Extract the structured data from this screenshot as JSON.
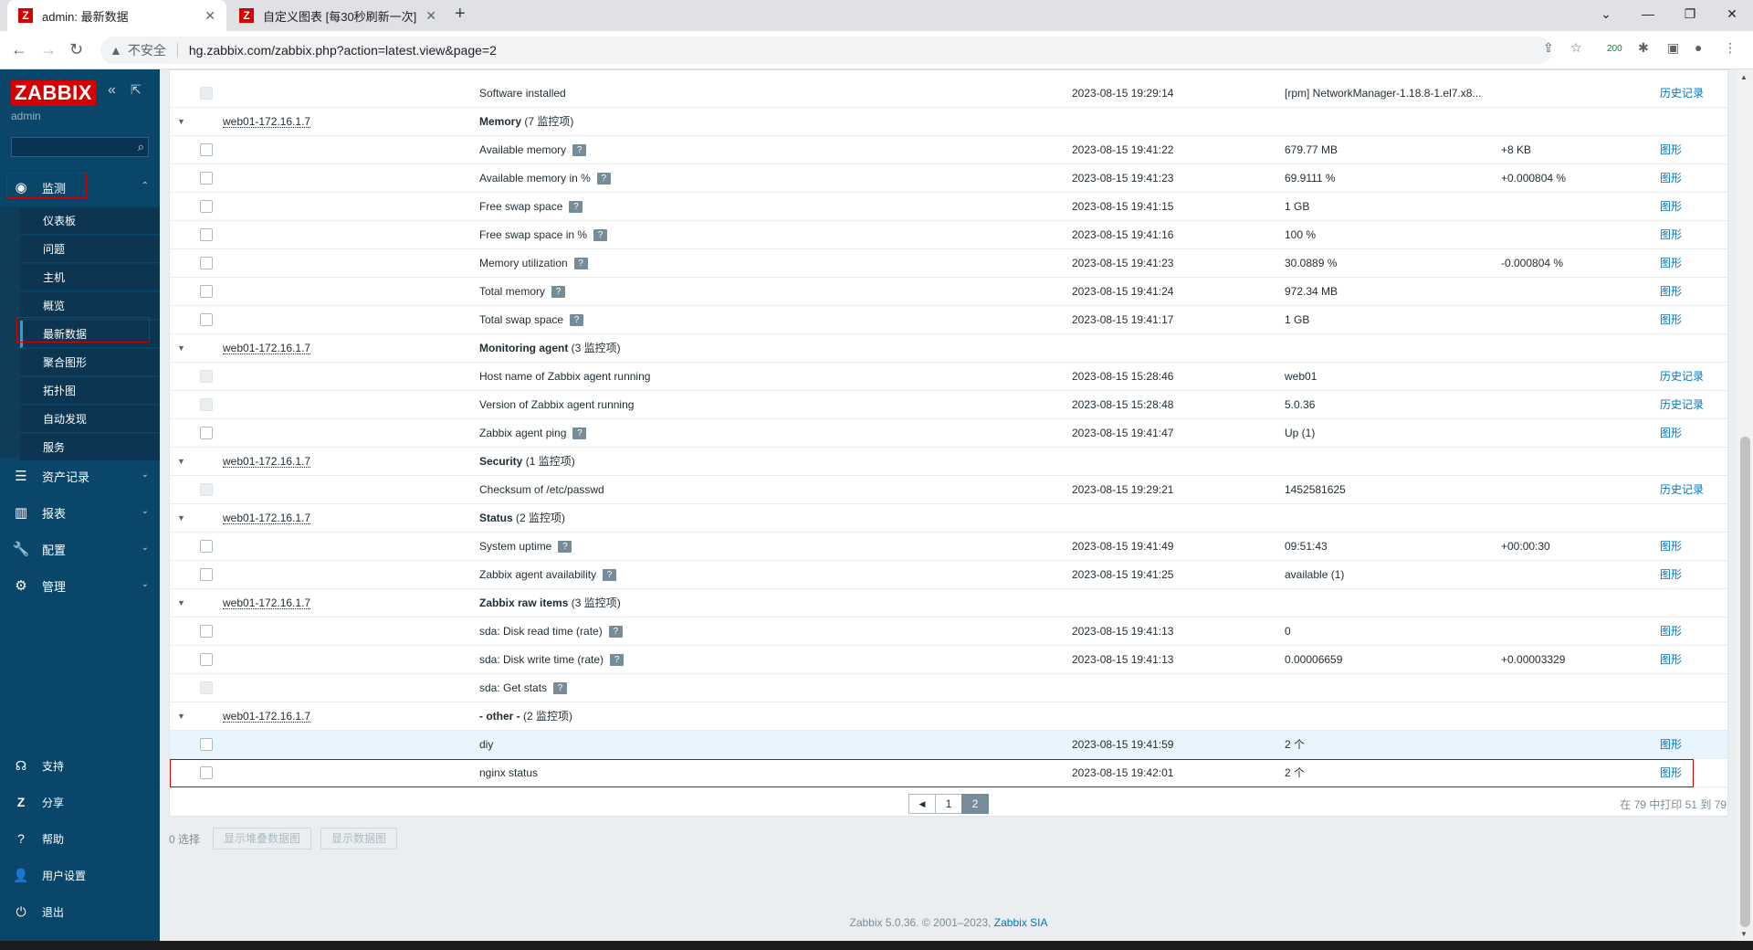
{
  "browser": {
    "tabs": [
      {
        "label": "admin: 最新数据",
        "favicon": "Z"
      },
      {
        "label": "自定义图表 [每30秒刷新一次]",
        "favicon": "Z"
      }
    ],
    "address": {
      "warning": "不安全",
      "url": "hg.zabbix.com/zabbix.php?action=latest.view&page=2"
    },
    "ext_badge": "200"
  },
  "sidebar": {
    "logo": "ZABBIX",
    "user": "admin",
    "search_placeholder": "",
    "main": [
      {
        "label": "监测",
        "icon": "eye-icon"
      },
      {
        "label": "资产记录",
        "icon": "list-icon"
      },
      {
        "label": "报表",
        "icon": "chart-icon"
      },
      {
        "label": "配置",
        "icon": "wrench-icon"
      },
      {
        "label": "管理",
        "icon": "gear-icon"
      }
    ],
    "submenu": [
      "仪表板",
      "问题",
      "主机",
      "概览",
      "最新数据",
      "聚合图形",
      "拓扑图",
      "自动发现",
      "服务"
    ],
    "bottom": [
      {
        "label": "支持",
        "icon": "support-icon"
      },
      {
        "label": "分享",
        "icon": "share-icon"
      },
      {
        "label": "帮助",
        "icon": "help-icon"
      },
      {
        "label": "用户设置",
        "icon": "user-icon"
      },
      {
        "label": "退出",
        "icon": "power-icon"
      }
    ]
  },
  "rows": [
    {
      "type": "item",
      "disabled": true,
      "name": "Software installed",
      "help": false,
      "ts": "2023-08-15 19:29:14",
      "value": "[rpm] NetworkManager-1.18.8-1.el7.x8...",
      "change": "",
      "action": "历史记录"
    },
    {
      "type": "group",
      "host": "web01-172.16.1.7",
      "group": "Memory",
      "count": "(7 监控项)"
    },
    {
      "type": "item",
      "name": "Available memory",
      "help": true,
      "ts": "2023-08-15 19:41:22",
      "value": "679.77 MB",
      "change": "+8 KB",
      "action": "图形"
    },
    {
      "type": "item",
      "name": "Available memory in %",
      "help": true,
      "ts": "2023-08-15 19:41:23",
      "value": "69.9111 %",
      "change": "+0.000804 %",
      "action": "图形"
    },
    {
      "type": "item",
      "name": "Free swap space",
      "help": true,
      "ts": "2023-08-15 19:41:15",
      "value": "1 GB",
      "change": "",
      "action": "图形"
    },
    {
      "type": "item",
      "name": "Free swap space in %",
      "help": true,
      "ts": "2023-08-15 19:41:16",
      "value": "100 %",
      "change": "",
      "action": "图形"
    },
    {
      "type": "item",
      "name": "Memory utilization",
      "help": true,
      "ts": "2023-08-15 19:41:23",
      "value": "30.0889 %",
      "change": "-0.000804 %",
      "action": "图形"
    },
    {
      "type": "item",
      "name": "Total memory",
      "help": true,
      "ts": "2023-08-15 19:41:24",
      "value": "972.34 MB",
      "change": "",
      "action": "图形"
    },
    {
      "type": "item",
      "name": "Total swap space",
      "help": true,
      "ts": "2023-08-15 19:41:17",
      "value": "1 GB",
      "change": "",
      "action": "图形"
    },
    {
      "type": "group",
      "host": "web01-172.16.1.7",
      "group": "Monitoring agent",
      "count": "(3 监控项)"
    },
    {
      "type": "item",
      "disabled": true,
      "name": "Host name of Zabbix agent running",
      "help": false,
      "ts": "2023-08-15 15:28:46",
      "value": "web01",
      "change": "",
      "action": "历史记录"
    },
    {
      "type": "item",
      "disabled": true,
      "name": "Version of Zabbix agent running",
      "help": false,
      "ts": "2023-08-15 15:28:48",
      "value": "5.0.36",
      "change": "",
      "action": "历史记录"
    },
    {
      "type": "item",
      "name": "Zabbix agent ping",
      "help": true,
      "ts": "2023-08-15 19:41:47",
      "value": "Up (1)",
      "change": "",
      "action": "图形"
    },
    {
      "type": "group",
      "host": "web01-172.16.1.7",
      "group": "Security",
      "count": "(1 监控项)"
    },
    {
      "type": "item",
      "disabled": true,
      "name": "Checksum of /etc/passwd",
      "help": false,
      "ts": "2023-08-15 19:29:21",
      "value": "1452581625",
      "change": "",
      "action": "历史记录"
    },
    {
      "type": "group",
      "host": "web01-172.16.1.7",
      "group": "Status",
      "count": "(2 监控项)"
    },
    {
      "type": "item",
      "name": "System uptime",
      "help": true,
      "ts": "2023-08-15 19:41:49",
      "value": "09:51:43",
      "change": "+00:00:30",
      "action": "图形"
    },
    {
      "type": "item",
      "name": "Zabbix agent availability",
      "help": true,
      "ts": "2023-08-15 19:41:25",
      "value": "available (1)",
      "change": "",
      "action": "图形"
    },
    {
      "type": "group",
      "host": "web01-172.16.1.7",
      "group": "Zabbix raw items",
      "count": "(3 监控项)"
    },
    {
      "type": "item",
      "name": "sda: Disk read time (rate)",
      "help": true,
      "ts": "2023-08-15 19:41:13",
      "value": "0",
      "change": "",
      "action": "图形"
    },
    {
      "type": "item",
      "name": "sda: Disk write time (rate)",
      "help": true,
      "ts": "2023-08-15 19:41:13",
      "value": "0.00006659",
      "change": "+0.00003329",
      "action": "图形"
    },
    {
      "type": "item",
      "disabled": true,
      "name": "sda: Get stats",
      "help": true,
      "ts": "",
      "value": "",
      "change": "",
      "action": ""
    },
    {
      "type": "group",
      "host": "web01-172.16.1.7",
      "group": "- other -",
      "count": "(2 监控项)"
    },
    {
      "type": "item",
      "hover": true,
      "name": "diy",
      "help": false,
      "ts": "2023-08-15 19:41:59",
      "value": "2 个",
      "change": "",
      "action": "图形"
    },
    {
      "type": "item",
      "name": "nginx status",
      "help": false,
      "ts": "2023-08-15 19:42:01",
      "value": "2 个",
      "change": "",
      "action": "图形"
    }
  ],
  "pager": {
    "prev": "◀",
    "pages": [
      "1",
      "2"
    ],
    "current": "2",
    "info": "在 79 中打印 51 到 79"
  },
  "actions": {
    "selected": "0 选择",
    "btn1": "显示堆叠数据图",
    "btn2": "显示数据图"
  },
  "footer": {
    "text": "Zabbix 5.0.36. © 2001–2023, ",
    "corp": "Zabbix SIA"
  }
}
